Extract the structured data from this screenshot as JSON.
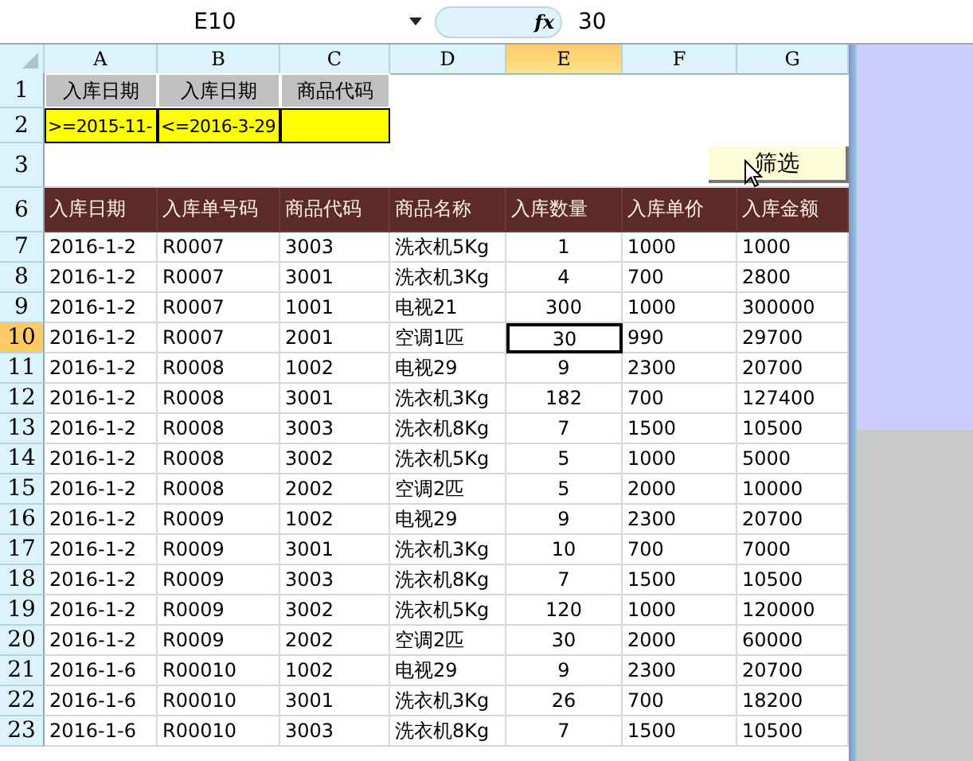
{
  "formula_bar": {
    "name_box": "E10",
    "fx": "fx",
    "value": "30"
  },
  "columns": [
    {
      "label": "A",
      "selected": false
    },
    {
      "label": "B",
      "selected": false
    },
    {
      "label": "C",
      "selected": false
    },
    {
      "label": "D",
      "selected": false
    },
    {
      "label": "E",
      "selected": true
    },
    {
      "label": "F",
      "selected": false
    },
    {
      "label": "G",
      "selected": false
    }
  ],
  "criteria": {
    "row_labels": [
      "1",
      "2"
    ],
    "headers": [
      "入库日期",
      "入库日期",
      "商品代码"
    ],
    "values": [
      ">=2015-11-",
      "<=2016-3-29"
    ]
  },
  "row_3": {
    "label": "3",
    "button": "筛选"
  },
  "table": {
    "row_label": "6",
    "headers": [
      "入库日期",
      "入库单号码",
      "商品代码",
      "商品名称",
      "入库数量",
      "入库单价",
      "入库金额"
    ],
    "rows": [
      {
        "n": "7",
        "selected": false,
        "cells": [
          "2016-1-2",
          "R0007",
          "3003",
          "洗衣机5Kg",
          "1",
          "1000",
          "1000"
        ]
      },
      {
        "n": "8",
        "selected": false,
        "cells": [
          "2016-1-2",
          "R0007",
          "3001",
          "洗衣机3Kg",
          "4",
          "700",
          "2800"
        ]
      },
      {
        "n": "9",
        "selected": false,
        "cells": [
          "2016-1-2",
          "R0007",
          "1001",
          "电视21",
          "300",
          "1000",
          "300000"
        ]
      },
      {
        "n": "10",
        "selected": true,
        "cells": [
          "2016-1-2",
          "R0007",
          "2001",
          "空调1匹",
          "30",
          "990",
          "29700"
        ]
      },
      {
        "n": "11",
        "selected": false,
        "cells": [
          "2016-1-2",
          "R0008",
          "1002",
          "电视29",
          "9",
          "2300",
          "20700"
        ]
      },
      {
        "n": "12",
        "selected": false,
        "cells": [
          "2016-1-2",
          "R0008",
          "3001",
          "洗衣机3Kg",
          "182",
          "700",
          "127400"
        ]
      },
      {
        "n": "13",
        "selected": false,
        "cells": [
          "2016-1-2",
          "R0008",
          "3003",
          "洗衣机8Kg",
          "7",
          "1500",
          "10500"
        ]
      },
      {
        "n": "14",
        "selected": false,
        "cells": [
          "2016-1-2",
          "R0008",
          "3002",
          "洗衣机5Kg",
          "5",
          "1000",
          "5000"
        ]
      },
      {
        "n": "15",
        "selected": false,
        "cells": [
          "2016-1-2",
          "R0008",
          "2002",
          "空调2匹",
          "5",
          "2000",
          "10000"
        ]
      },
      {
        "n": "16",
        "selected": false,
        "cells": [
          "2016-1-2",
          "R0009",
          "1002",
          "电视29",
          "9",
          "2300",
          "20700"
        ]
      },
      {
        "n": "17",
        "selected": false,
        "cells": [
          "2016-1-2",
          "R0009",
          "3001",
          "洗衣机3Kg",
          "10",
          "700",
          "7000"
        ]
      },
      {
        "n": "18",
        "selected": false,
        "cells": [
          "2016-1-2",
          "R0009",
          "3003",
          "洗衣机8Kg",
          "7",
          "1500",
          "10500"
        ]
      },
      {
        "n": "19",
        "selected": false,
        "cells": [
          "2016-1-2",
          "R0009",
          "3002",
          "洗衣机5Kg",
          "120",
          "1000",
          "120000"
        ]
      },
      {
        "n": "20",
        "selected": false,
        "cells": [
          "2016-1-2",
          "R0009",
          "2002",
          "空调2匹",
          "30",
          "2000",
          "60000"
        ]
      },
      {
        "n": "21",
        "selected": false,
        "cells": [
          "2016-1-6",
          "R00010",
          "1002",
          "电视29",
          "9",
          "2300",
          "20700"
        ]
      },
      {
        "n": "22",
        "selected": false,
        "cells": [
          "2016-1-6",
          "R00010",
          "3001",
          "洗衣机3Kg",
          "26",
          "700",
          "18200"
        ]
      },
      {
        "n": "23",
        "selected": false,
        "cells": [
          "2016-1-6",
          "R00010",
          "3003",
          "洗衣机8Kg",
          "7",
          "1500",
          "10500"
        ]
      }
    ]
  }
}
